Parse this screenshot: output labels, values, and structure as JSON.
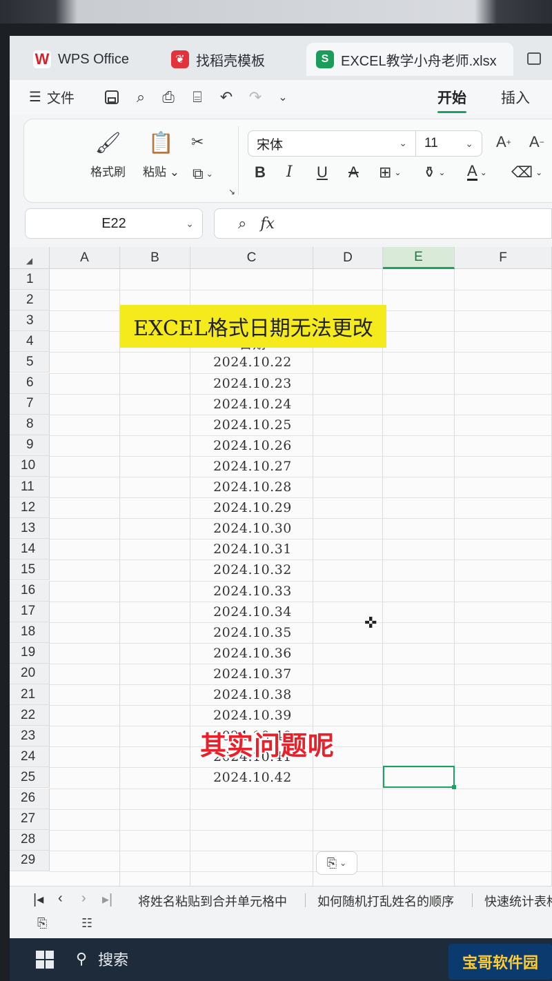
{
  "tabs": [
    {
      "label": "WPS Office",
      "logo": "W",
      "color": "#d6232b"
    },
    {
      "label": "找稻壳模板",
      "logo": "稻",
      "color": "#e0333c"
    },
    {
      "label": "EXCEL教学小舟老师.xlsx",
      "logo": "S",
      "color": "#1a9d5a"
    }
  ],
  "menu": {
    "file_label": "文件",
    "ribbon_tabs": [
      "开始",
      "插入"
    ]
  },
  "ribbon": {
    "format_painter": "格式刷",
    "paste": "粘贴",
    "font_name": "宋体",
    "font_size": "11"
  },
  "formula_bar": {
    "name_box": "E22",
    "fx": "fx",
    "content": ""
  },
  "grid": {
    "columns": [
      "A",
      "B",
      "C",
      "D",
      "E",
      "F"
    ],
    "rows": [
      "1",
      "2",
      "3",
      "4",
      "5",
      "6",
      "7",
      "8",
      "9",
      "10",
      "11",
      "12",
      "13",
      "14",
      "15",
      "16",
      "17",
      "18",
      "19",
      "20",
      "21",
      "22",
      "23",
      "24",
      "25",
      "26",
      "27",
      "28",
      "29"
    ],
    "title": "EXCEL格式日期无法更改",
    "header": "日期",
    "dates": [
      "2024.10.22",
      "2024.10.23",
      "2024.10.24",
      "2024.10.25",
      "2024.10.26",
      "2024.10.27",
      "2024.10.28",
      "2024.10.29",
      "2024.10.30",
      "2024.10.31",
      "2024.10.32",
      "2024.10.33",
      "2024.10.34",
      "2024.10.35",
      "2024.10.36",
      "2024.10.37",
      "2024.10.38",
      "2024.10.39",
      "2024.10.40",
      "2024.10.41",
      "2024.10.42"
    ],
    "selected_cell": "E22",
    "accent_color": "#1aa260"
  },
  "overlay_caption": "其实问题呢",
  "sheets": [
    "将姓名粘贴到合并单元格中",
    "如何随机打乱姓名的顺序",
    "快速统计表格"
  ],
  "taskbar": {
    "search_label": "搜索",
    "watermark": "宝哥软件园"
  }
}
